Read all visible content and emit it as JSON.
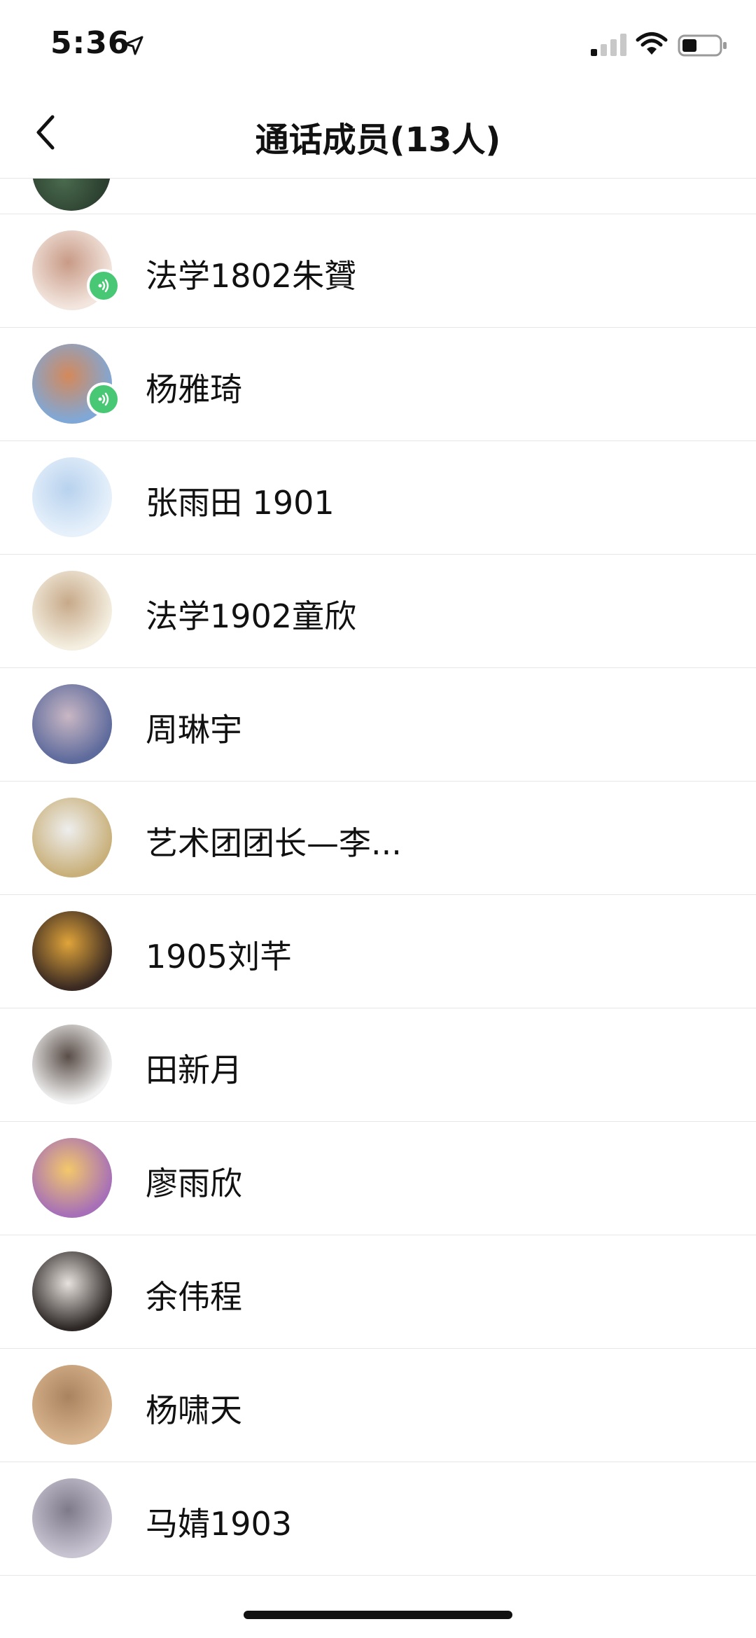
{
  "status_bar": {
    "time": "5:36",
    "icons": [
      "location-arrow-icon",
      "cellular-signal-icon",
      "wifi-icon",
      "battery-icon"
    ]
  },
  "header": {
    "title": "通话成员(13人)",
    "back_icon": "chevron-left-icon"
  },
  "members": [
    {
      "name": "法学1802朱贇",
      "speaking": true,
      "avatar_colors": [
        "#f3e6df",
        "#c89a86"
      ]
    },
    {
      "name": "杨雅琦",
      "speaking": true,
      "avatar_colors": [
        "#7fa8d8",
        "#d4895a"
      ]
    },
    {
      "name": "张雨田  1901",
      "speaking": false,
      "avatar_colors": [
        "#e7f1fb",
        "#b8d2ee"
      ]
    },
    {
      "name": "法学1902童欣",
      "speaking": false,
      "avatar_colors": [
        "#f4efe1",
        "#c7a989"
      ]
    },
    {
      "name": "周琳宇",
      "speaking": false,
      "avatar_colors": [
        "#5d6a9c",
        "#c9b7c4"
      ]
    },
    {
      "name": "艺术团团长—李...",
      "speaking": false,
      "avatar_colors": [
        "#c9b07a",
        "#eeeeee"
      ]
    },
    {
      "name": "1905刘芊",
      "speaking": false,
      "avatar_colors": [
        "#3a2a22",
        "#e0a43a"
      ]
    },
    {
      "name": "田新月",
      "speaking": false,
      "avatar_colors": [
        "#f2f2f2",
        "#5a4e48"
      ]
    },
    {
      "name": "廖雨欣",
      "speaking": false,
      "avatar_colors": [
        "#a66fb8",
        "#f3c86a"
      ]
    },
    {
      "name": "余伟程",
      "speaking": false,
      "avatar_colors": [
        "#2d2826",
        "#e8e2de"
      ]
    },
    {
      "name": "杨啸天",
      "speaking": false,
      "avatar_colors": [
        "#d8b48e",
        "#a9835f"
      ]
    },
    {
      "name": "马婧1903",
      "speaking": false,
      "avatar_colors": [
        "#c9c4d2",
        "#7f7a8a"
      ]
    }
  ]
}
